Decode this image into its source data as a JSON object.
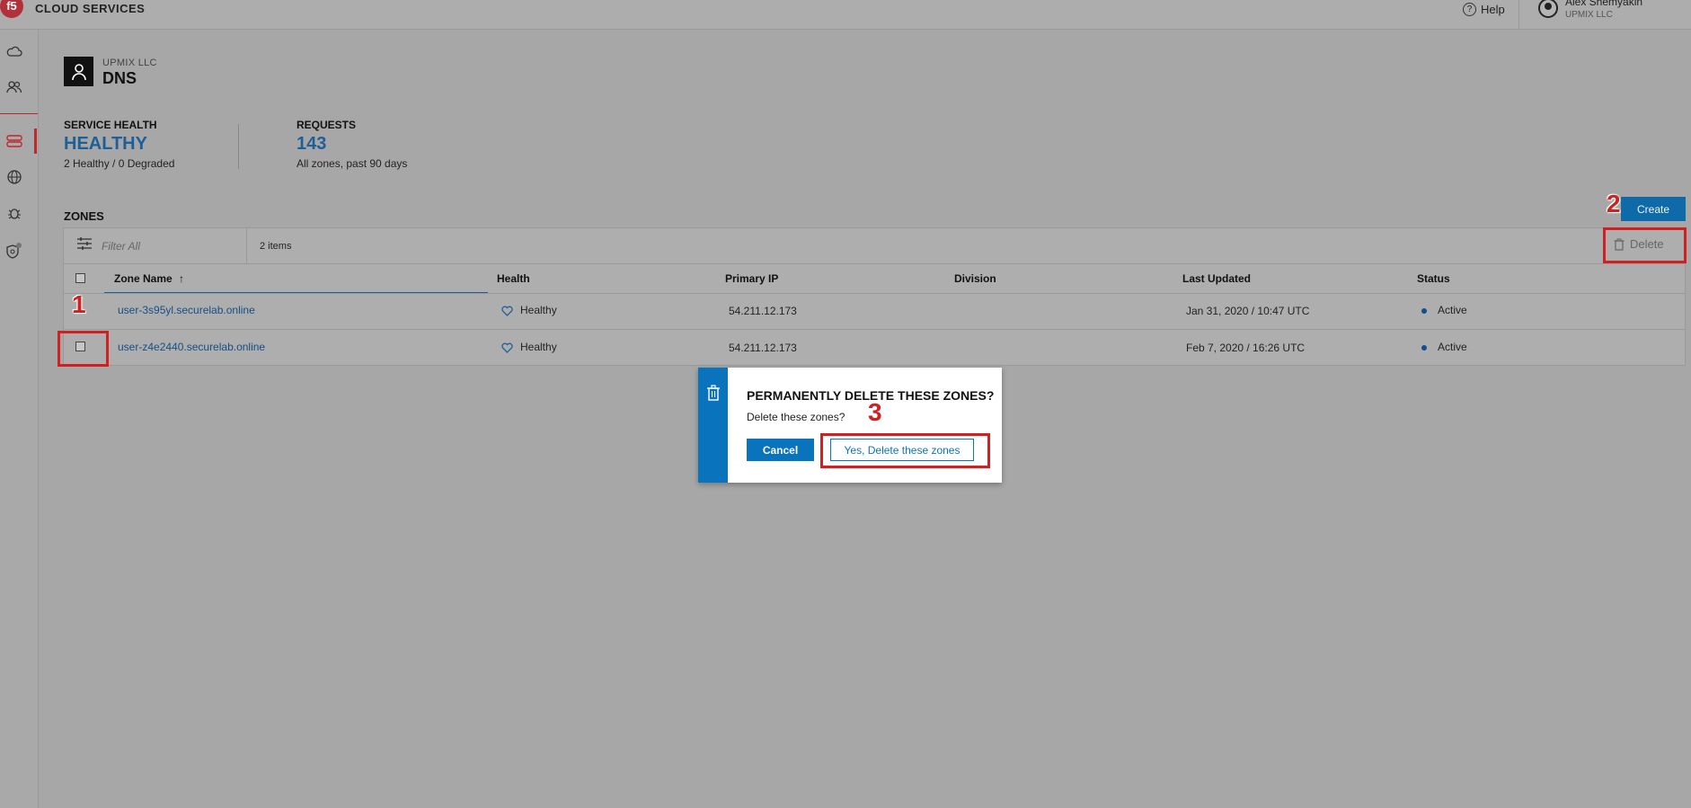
{
  "header": {
    "brand": "CLOUD SERVICES",
    "logo_text": "f5",
    "help_label": "Help",
    "user_name": "Alex Shemyakin",
    "user_org": "UPMIX LLC"
  },
  "service": {
    "org": "UPMIX LLC",
    "name": "DNS"
  },
  "stats": {
    "health_label": "SERVICE HEALTH",
    "health_value": "HEALTHY",
    "health_sub": "2 Healthy / 0 Degraded",
    "requests_label": "REQUESTS",
    "requests_value": "143",
    "requests_sub": "All zones, past 90 days"
  },
  "zones": {
    "title": "ZONES",
    "create_label": "Create",
    "delete_label": "Delete",
    "filter_placeholder": "Filter All",
    "items_count": "2 items",
    "columns": {
      "zone_name": "Zone Name",
      "sort_arrow": "↑",
      "health": "Health",
      "primary_ip": "Primary IP",
      "division": "Division",
      "last_updated": "Last Updated",
      "status": "Status"
    },
    "rows": [
      {
        "zone_name": "user-3s95yl.securelab.online",
        "health": "Healthy",
        "primary_ip": "54.211.12.173",
        "division": "",
        "last_updated": "Jan 31, 2020 / 10:47 UTC",
        "status": "Active"
      },
      {
        "zone_name": "user-z4e2440.securelab.online",
        "health": "Healthy",
        "primary_ip": "54.211.12.173",
        "division": "",
        "last_updated": "Feb 7, 2020 / 16:26 UTC",
        "status": "Active"
      }
    ]
  },
  "dialog": {
    "title": "PERMANENTLY DELETE THESE ZONES?",
    "message": "Delete these zones?",
    "cancel_label": "Cancel",
    "confirm_label": "Yes, Delete these zones"
  },
  "annotations": {
    "step1": "1",
    "step2": "2",
    "step3": "3",
    "color": "#d21f1f"
  },
  "colors": {
    "accent": "#0a73bd",
    "brand_red": "#c1272d",
    "link": "#164f86"
  }
}
